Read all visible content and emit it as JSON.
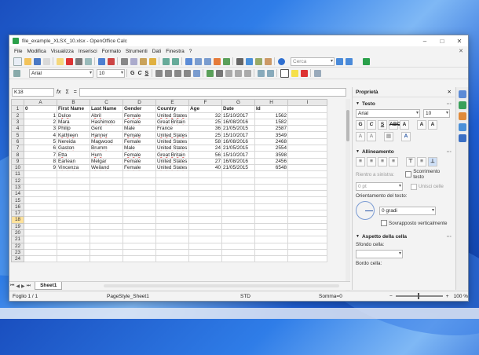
{
  "window": {
    "title": "file_example_XLSX_10.xlsx - OpenOffice Calc",
    "minimize": "–",
    "maximize": "□",
    "close": "✕"
  },
  "menu": [
    "File",
    "Modifica",
    "Visualizza",
    "Inserisci",
    "Formato",
    "Strumenti",
    "Dati",
    "Finestra",
    "?"
  ],
  "menu_close": "✕",
  "toolbar": {
    "search_placeholder": "Cerca",
    "font_name": "Arial",
    "font_size": "10"
  },
  "formula_bar": {
    "cell_ref": "K18",
    "fx": "fx",
    "sum": "Σ",
    "equals": "="
  },
  "columns": [
    "A",
    "B",
    "C",
    "D",
    "E",
    "F",
    "G",
    "H",
    "I"
  ],
  "rows": [
    {
      "n": "1",
      "A": "0",
      "B": "First Name",
      "C": "Last Name",
      "D": "Gender",
      "E": "Country",
      "F": "Age",
      "G": "Date",
      "H": "Id"
    },
    {
      "n": "2",
      "A": "1",
      "B": "Dulce",
      "C": "Abril",
      "D": "Female",
      "E": "United States",
      "F": "32",
      "G": "15/10/2017",
      "H": "1562"
    },
    {
      "n": "3",
      "A": "2",
      "B": "Mara",
      "C": "Hashimoto",
      "D": "Female",
      "E": "Great Britain",
      "F": "25",
      "G": "16/08/2016",
      "H": "1582"
    },
    {
      "n": "4",
      "A": "3",
      "B": "Philip",
      "C": "Gent",
      "D": "Male",
      "E": "France",
      "F": "36",
      "G": "21/05/2015",
      "H": "2587"
    },
    {
      "n": "5",
      "A": "4",
      "B": "Kathleen",
      "C": "Hanner",
      "D": "Female",
      "E": "United States",
      "F": "25",
      "G": "15/10/2017",
      "H": "3549"
    },
    {
      "n": "6",
      "A": "5",
      "B": "Nereida",
      "C": "Magwood",
      "D": "Female",
      "E": "United States",
      "F": "58",
      "G": "16/08/2016",
      "H": "2468"
    },
    {
      "n": "7",
      "A": "6",
      "B": "Gaston",
      "C": "Brumm",
      "D": "Male",
      "E": "United States",
      "F": "24",
      "G": "21/05/2015",
      "H": "2554"
    },
    {
      "n": "8",
      "A": "7",
      "B": "Etta",
      "C": "Hurn",
      "D": "Female",
      "E": "Great Britain",
      "F": "56",
      "G": "15/10/2017",
      "H": "3598"
    },
    {
      "n": "9",
      "A": "8",
      "B": "Earlean",
      "C": "Melgar",
      "D": "Female",
      "E": "United States",
      "F": "27",
      "G": "16/08/2016",
      "H": "2456"
    },
    {
      "n": "10",
      "A": "9",
      "B": "Vincenza",
      "C": "Weiland",
      "D": "Female",
      "E": "United States",
      "F": "40",
      "G": "21/05/2015",
      "H": "6548"
    },
    {
      "n": "11"
    },
    {
      "n": "12"
    },
    {
      "n": "13"
    },
    {
      "n": "14"
    },
    {
      "n": "15"
    },
    {
      "n": "16"
    },
    {
      "n": "17"
    },
    {
      "n": "18"
    },
    {
      "n": "19"
    },
    {
      "n": "20"
    },
    {
      "n": "21"
    },
    {
      "n": "22"
    },
    {
      "n": "23"
    },
    {
      "n": "24"
    }
  ],
  "selected_row": "18",
  "sheet_tab": "Sheet1",
  "status": {
    "sheet": "Foglio 1 / 1",
    "style": "PageStyle_Sheet1",
    "mode": "STD",
    "sum": "Somma=0",
    "zoom": "100 %"
  },
  "sidebar": {
    "title": "Proprietà",
    "close": "✕",
    "text_section": "Testo",
    "font": "Arial",
    "size": "10",
    "bold": "G",
    "strike": "S",
    "italic": "C",
    "align_section": "Allineamento",
    "indent_label": "Rientro a sinistra:",
    "indent_value": "0 pt",
    "wrap_label": "Scorrimento testo",
    "merge_label": "Unisci celle",
    "orientation_label": "Orientamento del testo:",
    "orientation_value": "0 gradi",
    "overlap_label": "Sovrapposto verticalmente",
    "cell_section": "Aspetto della cella",
    "bg_label": "Sfondo cella:",
    "border_label": "Bordo cella:"
  }
}
